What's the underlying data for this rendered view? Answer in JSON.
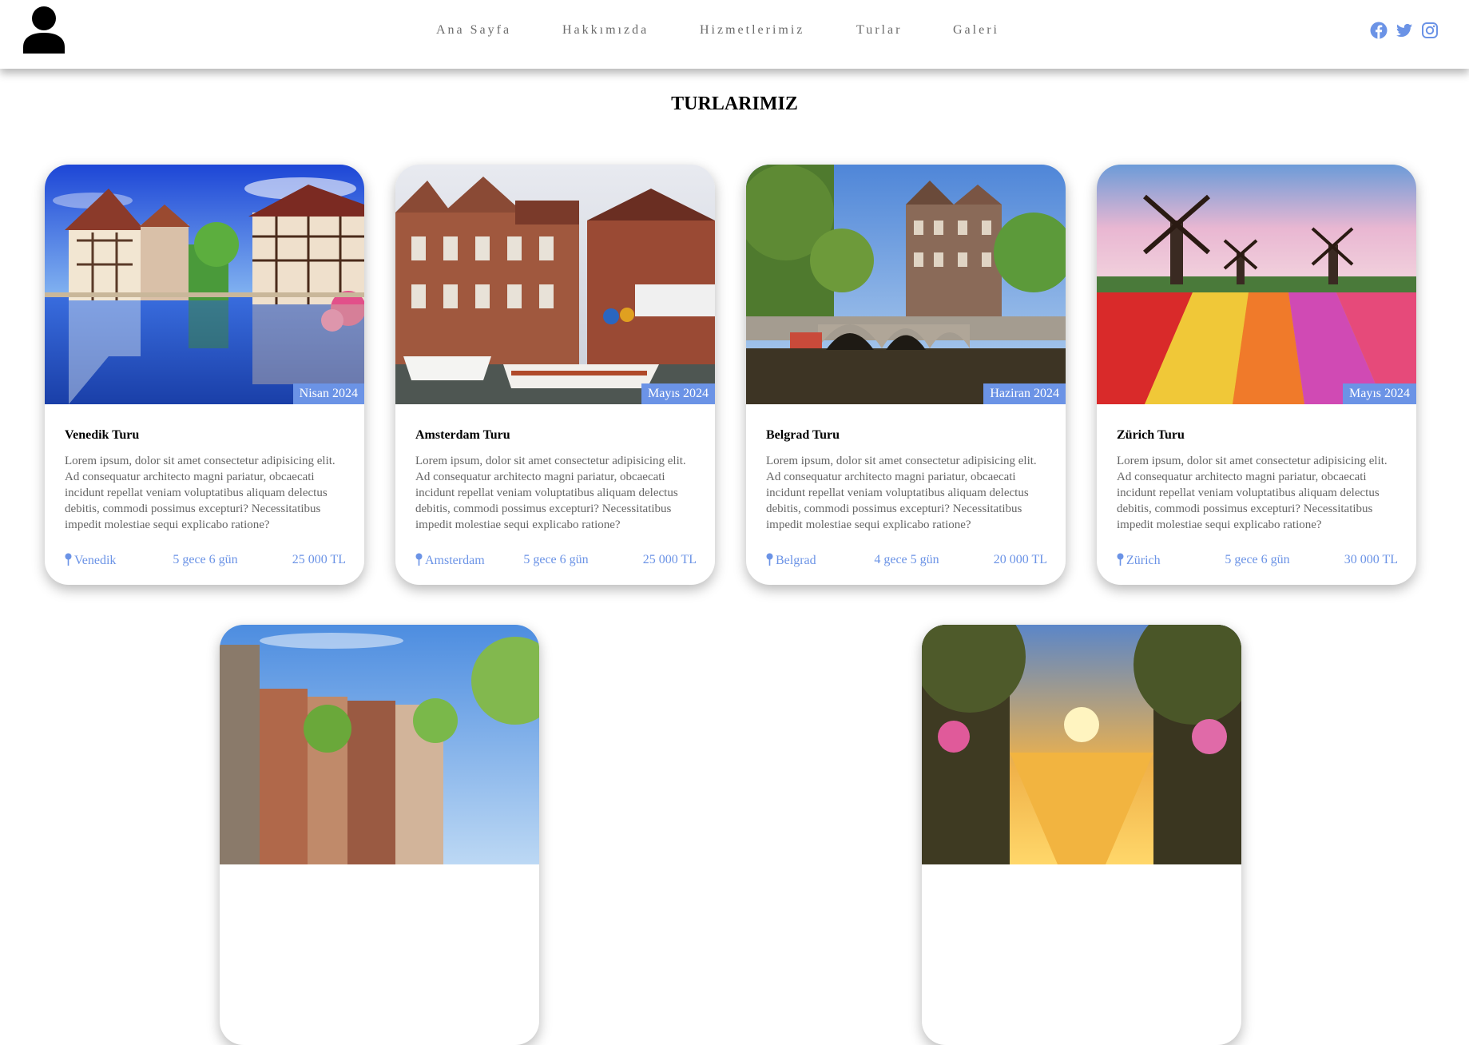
{
  "nav": {
    "links": [
      "Ana Sayfa",
      "Hakkımızda",
      "Hizmetlerimiz",
      "Turlar",
      "Galeri"
    ]
  },
  "social": [
    "facebook-icon",
    "twitter-icon",
    "instagram-icon"
  ],
  "colors": {
    "accent": "#6b93e6",
    "text_muted": "#666666",
    "nav_text": "#6b6b6b"
  },
  "page": {
    "title": "TURLARIMIZ"
  },
  "tours": [
    {
      "title": "Venedik Turu",
      "date": "Nisan 2024",
      "description": "Lorem ipsum, dolor sit amet consectetur adipisicing elit. Ad consequatur architecto magni pariatur, obcaecati incidunt repellat veniam voluptatibus aliquam delectus debitis, commodi possimus excepturi? Necessitatibus impedit molestiae sequi explicabo ratione?",
      "location": "Venedik",
      "duration": "5 gece 6 gün",
      "price": "25 000 TL"
    },
    {
      "title": "Amsterdam Turu",
      "date": "Mayıs 2024",
      "description": "Lorem ipsum, dolor sit amet consectetur adipisicing elit. Ad consequatur architecto magni pariatur, obcaecati incidunt repellat veniam voluptatibus aliquam delectus debitis, commodi possimus excepturi? Necessitatibus impedit molestiae sequi explicabo ratione?",
      "location": "Amsterdam",
      "duration": "5 gece 6 gün",
      "price": "25 000 TL"
    },
    {
      "title": "Belgrad Turu",
      "date": "Haziran 2024",
      "description": "Lorem ipsum, dolor sit amet consectetur adipisicing elit. Ad consequatur architecto magni pariatur, obcaecati incidunt repellat veniam voluptatibus aliquam delectus debitis, commodi possimus excepturi? Necessitatibus impedit molestiae sequi explicabo ratione?",
      "location": "Belgrad",
      "duration": "4 gece 5 gün",
      "price": "20 000 TL"
    },
    {
      "title": "Zürich Turu",
      "date": "Mayıs 2024",
      "description": "Lorem ipsum, dolor sit amet consectetur adipisicing elit. Ad consequatur architecto magni pariatur, obcaecati incidunt repellat veniam voluptatibus aliquam delectus debitis, commodi possimus excepturi? Necessitatibus impedit molestiae sequi explicabo ratione?",
      "location": "Zürich",
      "duration": "5 gece 6 gün",
      "price": "30 000 TL"
    }
  ]
}
